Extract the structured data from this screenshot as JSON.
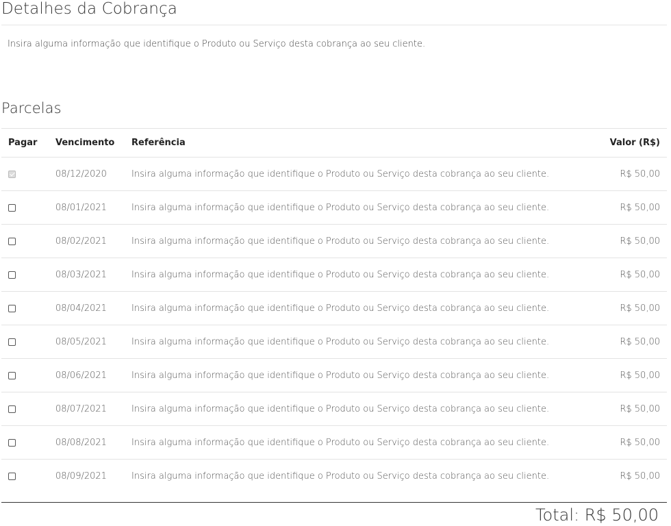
{
  "details": {
    "title": "Detalhes da Cobrança",
    "description": "Insira alguma informação que identifique o Produto ou Serviço desta cobrança ao seu cliente."
  },
  "installments": {
    "title": "Parcelas",
    "headers": {
      "pagar": "Pagar",
      "vencimento": "Vencimento",
      "referencia": "Referência",
      "valor": "Valor (R$)"
    },
    "rows": [
      {
        "checked": true,
        "disabled": true,
        "due": "08/12/2020",
        "reference": "Insira alguma informação que identifique o Produto ou Serviço desta cobrança ao seu cliente.",
        "value": "R$ 50,00"
      },
      {
        "checked": false,
        "disabled": false,
        "due": "08/01/2021",
        "reference": "Insira alguma informação que identifique o Produto ou Serviço desta cobrança ao seu cliente.",
        "value": "R$ 50,00"
      },
      {
        "checked": false,
        "disabled": false,
        "due": "08/02/2021",
        "reference": "Insira alguma informação que identifique o Produto ou Serviço desta cobrança ao seu cliente.",
        "value": "R$ 50,00"
      },
      {
        "checked": false,
        "disabled": false,
        "due": "08/03/2021",
        "reference": "Insira alguma informação que identifique o Produto ou Serviço desta cobrança ao seu cliente.",
        "value": "R$ 50,00"
      },
      {
        "checked": false,
        "disabled": false,
        "due": "08/04/2021",
        "reference": "Insira alguma informação que identifique o Produto ou Serviço desta cobrança ao seu cliente.",
        "value": "R$ 50,00"
      },
      {
        "checked": false,
        "disabled": false,
        "due": "08/05/2021",
        "reference": "Insira alguma informação que identifique o Produto ou Serviço desta cobrança ao seu cliente.",
        "value": "R$ 50,00"
      },
      {
        "checked": false,
        "disabled": false,
        "due": "08/06/2021",
        "reference": "Insira alguma informação que identifique o Produto ou Serviço desta cobrança ao seu cliente.",
        "value": "R$ 50,00"
      },
      {
        "checked": false,
        "disabled": false,
        "due": "08/07/2021",
        "reference": "Insira alguma informação que identifique o Produto ou Serviço desta cobrança ao seu cliente.",
        "value": "R$ 50,00"
      },
      {
        "checked": false,
        "disabled": false,
        "due": "08/08/2021",
        "reference": "Insira alguma informação que identifique o Produto ou Serviço desta cobrança ao seu cliente.",
        "value": "R$ 50,00"
      },
      {
        "checked": false,
        "disabled": false,
        "due": "08/09/2021",
        "reference": "Insira alguma informação que identifique o Produto ou Serviço desta cobrança ao seu cliente.",
        "value": "R$ 50,00"
      }
    ]
  },
  "total": {
    "label": "Total: R$ 50,00"
  }
}
